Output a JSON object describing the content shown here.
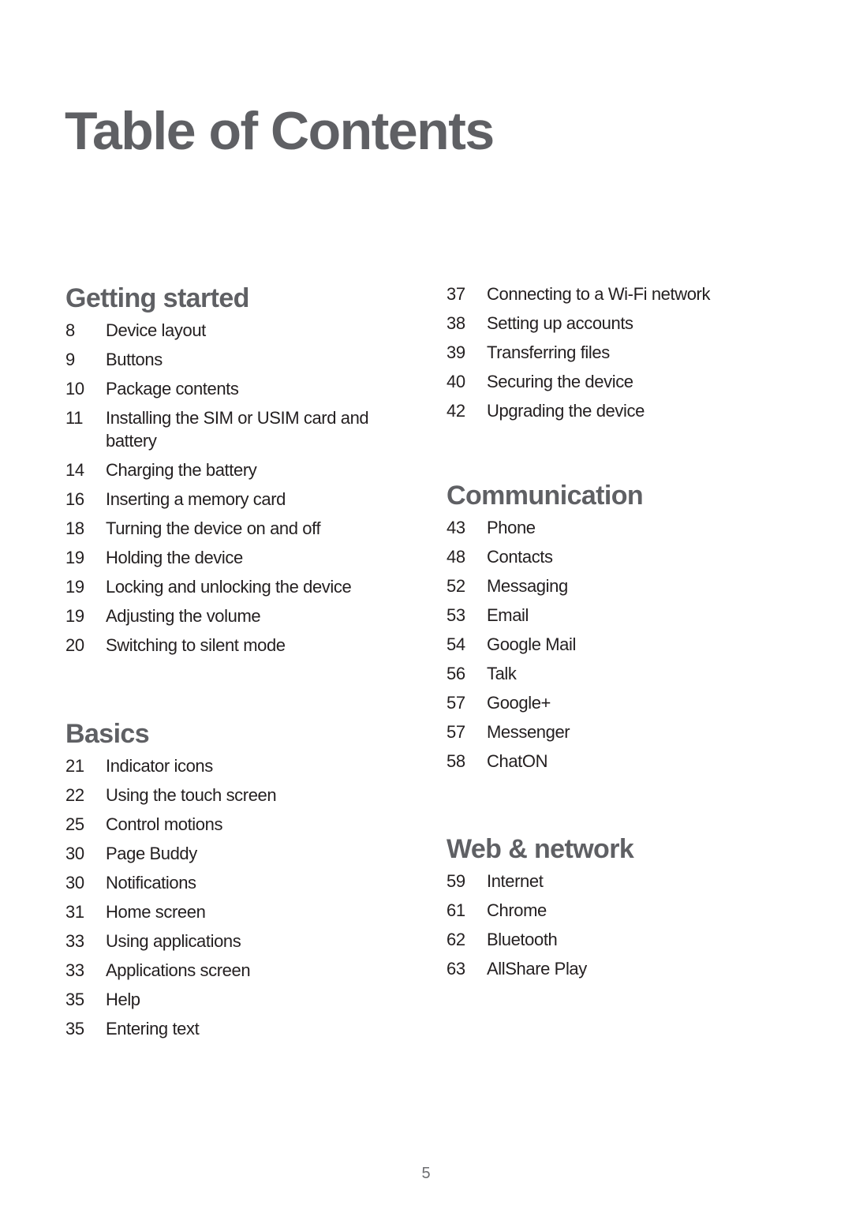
{
  "page": {
    "title": "Table of Contents",
    "page_number": "5"
  },
  "sections": {
    "getting_started": {
      "heading": "Getting started",
      "entries": [
        {
          "page": "8",
          "title": "Device layout"
        },
        {
          "page": "9",
          "title": "Buttons"
        },
        {
          "page": "10",
          "title": "Package contents"
        },
        {
          "page": "11",
          "title": "Installing the SIM or USIM card and battery"
        },
        {
          "page": "14",
          "title": "Charging the battery"
        },
        {
          "page": "16",
          "title": "Inserting a memory card"
        },
        {
          "page": "18",
          "title": "Turning the device on and off"
        },
        {
          "page": "19",
          "title": "Holding the device"
        },
        {
          "page": "19",
          "title": "Locking and unlocking the device"
        },
        {
          "page": "19",
          "title": "Adjusting the volume"
        },
        {
          "page": "20",
          "title": "Switching to silent mode"
        }
      ]
    },
    "basics": {
      "heading": "Basics",
      "entries": [
        {
          "page": "21",
          "title": "Indicator icons"
        },
        {
          "page": "22",
          "title": "Using the touch screen"
        },
        {
          "page": "25",
          "title": "Control motions"
        },
        {
          "page": "30",
          "title": "Page Buddy"
        },
        {
          "page": "30",
          "title": "Notifications"
        },
        {
          "page": "31",
          "title": "Home screen"
        },
        {
          "page": "33",
          "title": "Using applications"
        },
        {
          "page": "33",
          "title": "Applications screen"
        },
        {
          "page": "35",
          "title": "Help"
        },
        {
          "page": "35",
          "title": "Entering text"
        }
      ]
    },
    "basics_continued": {
      "entries": [
        {
          "page": "37",
          "title": "Connecting to a Wi-Fi network"
        },
        {
          "page": "38",
          "title": "Setting up accounts"
        },
        {
          "page": "39",
          "title": "Transferring files"
        },
        {
          "page": "40",
          "title": "Securing the device"
        },
        {
          "page": "42",
          "title": "Upgrading the device"
        }
      ]
    },
    "communication": {
      "heading": "Communication",
      "entries": [
        {
          "page": "43",
          "title": "Phone"
        },
        {
          "page": "48",
          "title": "Contacts"
        },
        {
          "page": "52",
          "title": "Messaging"
        },
        {
          "page": "53",
          "title": "Email"
        },
        {
          "page": "54",
          "title": "Google Mail"
        },
        {
          "page": "56",
          "title": "Talk"
        },
        {
          "page": "57",
          "title": "Google+"
        },
        {
          "page": "57",
          "title": "Messenger"
        },
        {
          "page": "58",
          "title": "ChatON"
        }
      ]
    },
    "web_network": {
      "heading": "Web & network",
      "entries": [
        {
          "page": "59",
          "title": "Internet"
        },
        {
          "page": "61",
          "title": "Chrome"
        },
        {
          "page": "62",
          "title": "Bluetooth"
        },
        {
          "page": "63",
          "title": "AllShare Play"
        }
      ]
    }
  }
}
